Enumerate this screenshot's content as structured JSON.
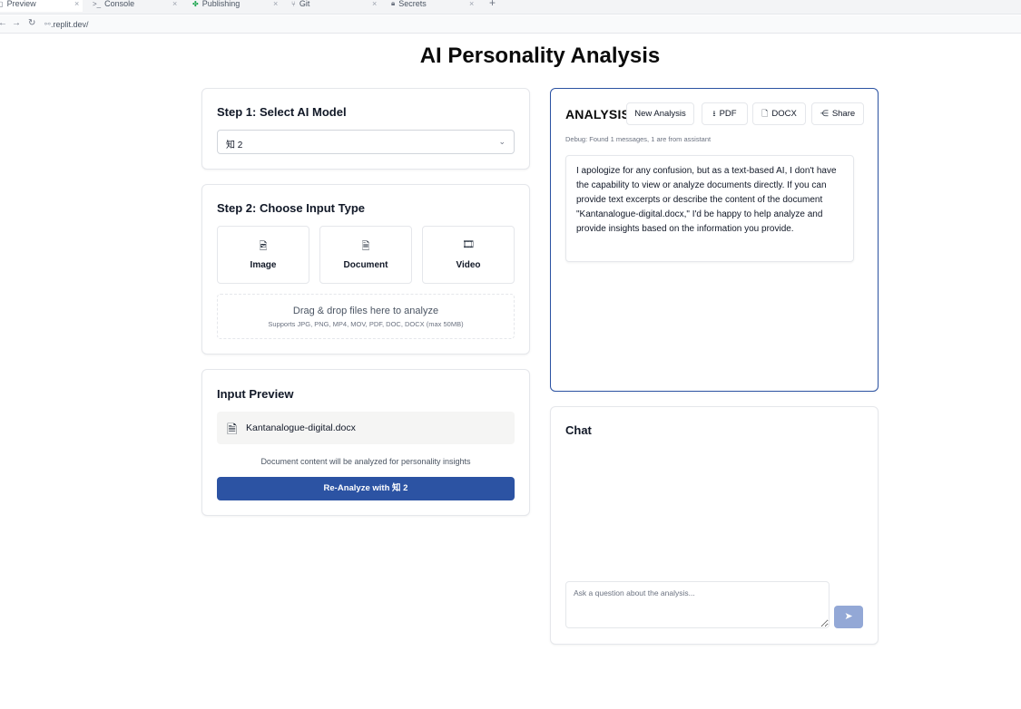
{
  "browser": {
    "tabs": [
      {
        "label": "Preview",
        "icon": "preview-icon",
        "active": true
      },
      {
        "label": "Console",
        "icon": ">_",
        "active": false
      },
      {
        "label": "Publishing",
        "icon": "publishing-icon",
        "active": false
      },
      {
        "label": "Git",
        "icon": "git-icon",
        "active": false
      },
      {
        "label": "Secrets",
        "icon": "lock-icon",
        "active": false
      }
    ],
    "url": ".replit.dev/"
  },
  "page": {
    "title": "AI Personality Analysis"
  },
  "step1": {
    "title": "Step 1: Select AI Model",
    "selected_model": "知 2"
  },
  "step2": {
    "title": "Step 2: Choose Input Type",
    "types": [
      {
        "label": "Image",
        "icon": "image-file-icon"
      },
      {
        "label": "Document",
        "icon": "document-file-icon"
      },
      {
        "label": "Video",
        "icon": "film-icon"
      }
    ],
    "dropzone_main": "Drag & drop files here to analyze",
    "dropzone_sub": "Supports JPG, PNG, MP4, MOV, PDF, DOC, DOCX (max 50MB)"
  },
  "preview": {
    "title": "Input Preview",
    "file_name": "Kantanalogue-digital.docx",
    "note": "Document content will be analyzed for personality insights",
    "reanalyze_label": "Re-Analyze with 知 2"
  },
  "analysis": {
    "title": "ANALYSIS",
    "new_label": "New Analysis",
    "pdf_label": "PDF",
    "docx_label": "DOCX",
    "share_label": "Share",
    "debug": "Debug: Found 1 messages, 1 are from assistant",
    "message": "I apologize for any confusion, but as a text-based AI, I don't have the capability to view or analyze documents directly. If you can provide text excerpts or describe the content of the document \"Kantanalogue-digital.docx,\" I'd be happy to help analyze and provide insights based on the information you provide."
  },
  "chat": {
    "title": "Chat",
    "placeholder": "Ask a question about the analysis..."
  },
  "colors": {
    "primary": "#2c53a3",
    "send_disabled": "#93a8d6",
    "border": "#e5e7eb"
  }
}
